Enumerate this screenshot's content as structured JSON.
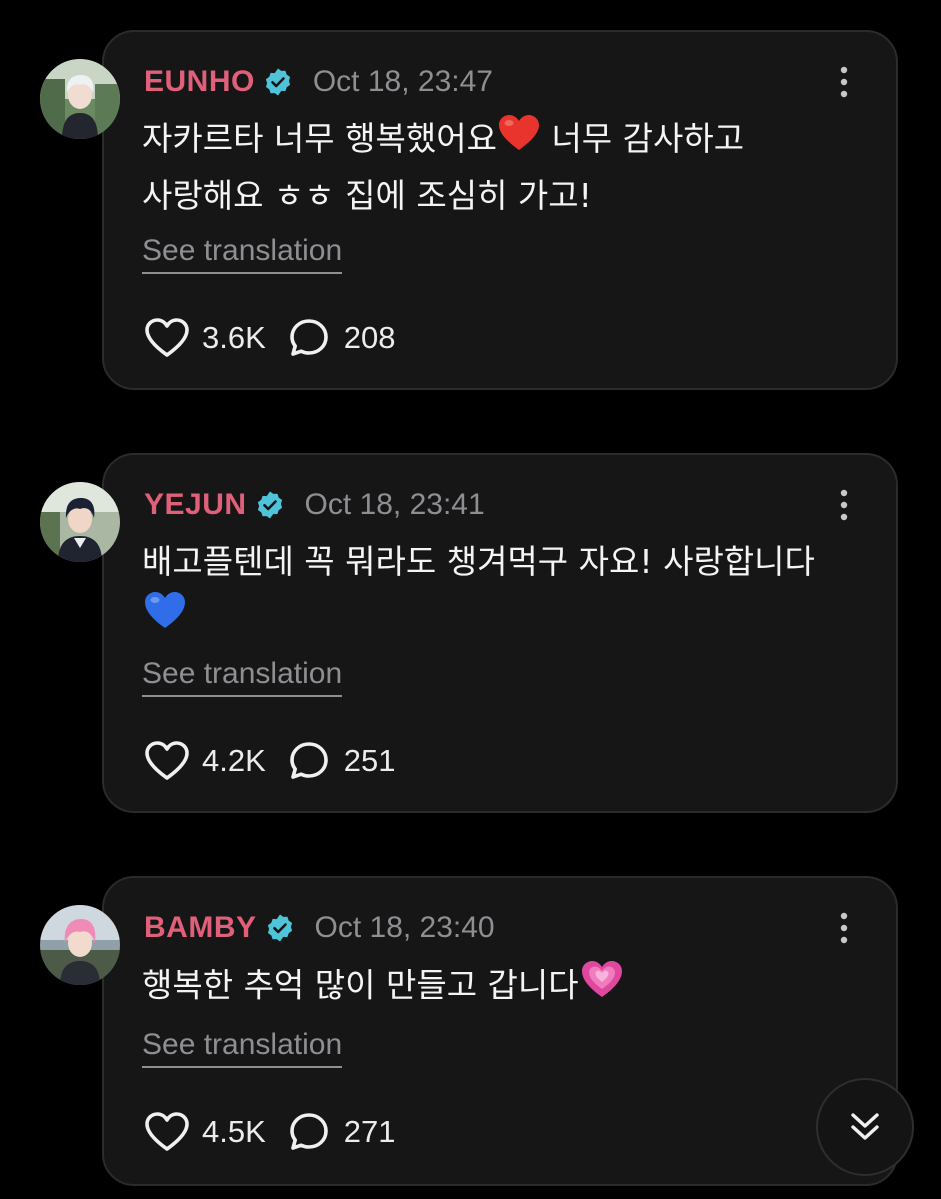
{
  "posts": [
    {
      "username": "EUNHO",
      "timestamp": "Oct 18, 23:47",
      "text_line1": "자카르타 너무 행복했어요",
      "text_line1_after": " 너무 감사하고",
      "text_line2": "사랑해요 ㅎㅎ 집에 조심히 가고!",
      "emoji": "red-heart",
      "translate_label": "See translation",
      "likes": "3.6K",
      "comments": "208"
    },
    {
      "username": "YEJUN",
      "timestamp": "Oct 18, 23:41",
      "text_line1": "배고플텐데 꼭 뭐라도 챙겨먹구 자요! 사랑합니다",
      "emoji": "blue-heart",
      "translate_label": "See translation",
      "likes": "4.2K",
      "comments": "251"
    },
    {
      "username": "BAMBY",
      "timestamp": "Oct 18, 23:40",
      "text_line1": "행복한 추억 많이 만들고 갑니다",
      "emoji": "growing-heart",
      "translate_label": "See translation",
      "likes": "4.5K",
      "comments": "271"
    }
  ],
  "colors": {
    "username": "#e0607a",
    "verified": "#4fc3d9",
    "muted": "#8e8e93",
    "card_bg": "#161616"
  },
  "icons": {
    "verified": "verified-badge-icon",
    "more": "more-vertical-icon",
    "like": "heart-outline-icon",
    "comment": "comment-bubble-icon",
    "scroll": "double-chevron-down-icon"
  }
}
